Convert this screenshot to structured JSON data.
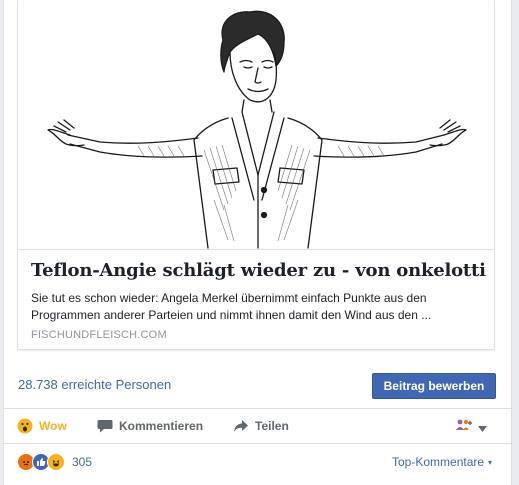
{
  "link_card": {
    "image_alt": "",
    "title": "Teflon-Angie schlägt wieder zu - von onkelotti",
    "description": "Sie tut es schon wieder: Angela Merkel übernimmt einfach Punkte aus den Programmen anderer Parteien und nimmt ihnen damit den Wind aus den ...",
    "domain": "FISCHUNDFLEISCH.COM"
  },
  "reach": {
    "text": "28.738 erreichte Personen",
    "promote_label": "Beitrag bewerben"
  },
  "actions": {
    "wow_label": "Wow",
    "comment_label": "Kommentieren",
    "share_label": "Teilen",
    "audience_icon": "people-plus-icon"
  },
  "reactions": {
    "icons": [
      "angry-icon",
      "like-icon",
      "haha-icon"
    ],
    "count": "305",
    "sort_label": "Top-Kommentare"
  },
  "colors": {
    "link_blue": "#4267b2",
    "wow_yellow": "#f7b125",
    "border": "#dddfe2"
  }
}
